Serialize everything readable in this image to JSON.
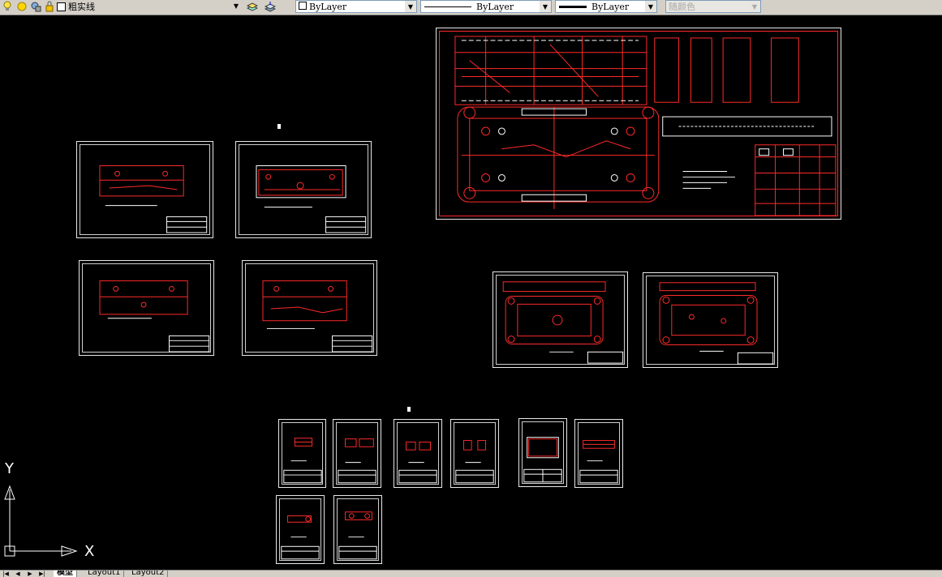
{
  "toolbar": {
    "layer_name": "粗实线",
    "color_combo": "ByLayer",
    "linetype_combo": "ByLayer",
    "lineweight_combo": "ByLayer",
    "plotstyle_combo": "随颜色"
  },
  "ucs": {
    "y_label": "Y",
    "x_label": "X"
  },
  "tabs": [
    {
      "label": "模型",
      "active": true
    },
    {
      "label": "Layout1",
      "active": false
    },
    {
      "label": "Layout2",
      "active": false
    }
  ],
  "colors": {
    "background": "#000000",
    "drawing_red": "#ff1a1a",
    "drawing_white": "#ffffff",
    "toolbar": "#d4d0c8"
  }
}
